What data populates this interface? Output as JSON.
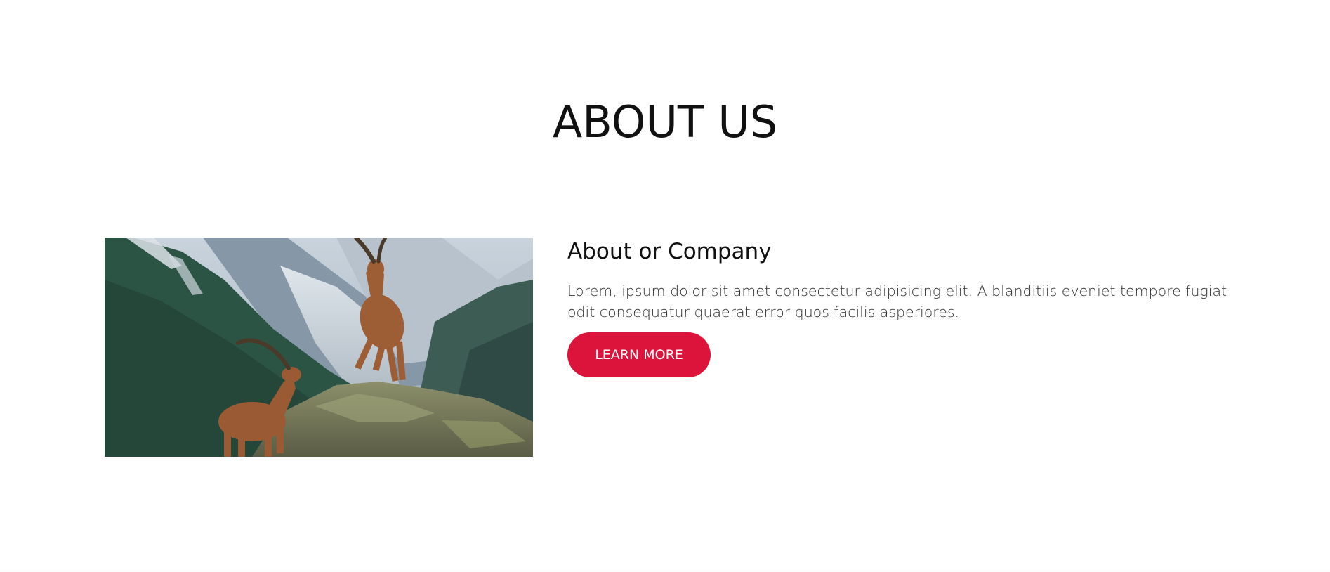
{
  "section": {
    "title": "ABOUT US"
  },
  "about": {
    "heading": "About or Company",
    "text": "Lorem, ipsum dolor sit amet consectetur adipisicing elit. A blanditiis eveniet tempore fugiat odit consequatur quaerat error quos facilis asperiores.",
    "button_label": "LEARN MORE",
    "image_alt": "ibex-on-mountain-photo"
  },
  "colors": {
    "accent": "#dc143c",
    "background": "#ffffff",
    "text": "#111111"
  }
}
